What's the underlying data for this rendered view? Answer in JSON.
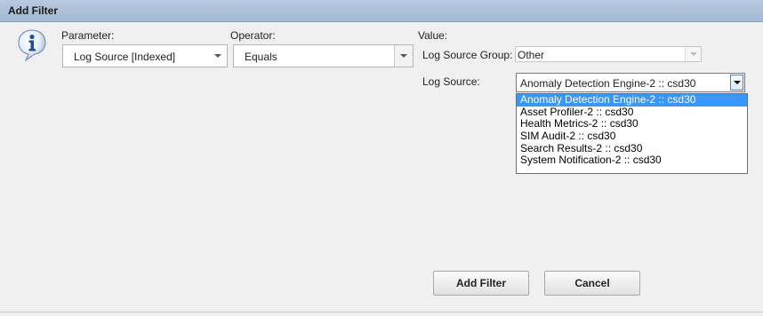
{
  "window": {
    "title": "Add Filter"
  },
  "icons": {
    "info": "info-icon"
  },
  "parameter": {
    "label": "Parameter:",
    "value": "Log Source [Indexed]"
  },
  "operator": {
    "label": "Operator:",
    "value": "Equals"
  },
  "value": {
    "label": "Value:",
    "log_source_group": {
      "label": "Log Source Group:",
      "value": "Other",
      "disabled": true
    },
    "log_source": {
      "label": "Log Source:",
      "value": "Anomaly Detection Engine-2 :: csd30",
      "options": [
        "Anomaly Detection Engine-2 :: csd30",
        "Asset Profiler-2 :: csd30",
        "Health Metrics-2 :: csd30",
        "SIM Audit-2 :: csd30",
        "Search Results-2 :: csd30",
        "System Notification-2 :: csd30"
      ],
      "selected_index": 0
    }
  },
  "buttons": {
    "add_filter": "Add Filter",
    "cancel": "Cancel"
  }
}
